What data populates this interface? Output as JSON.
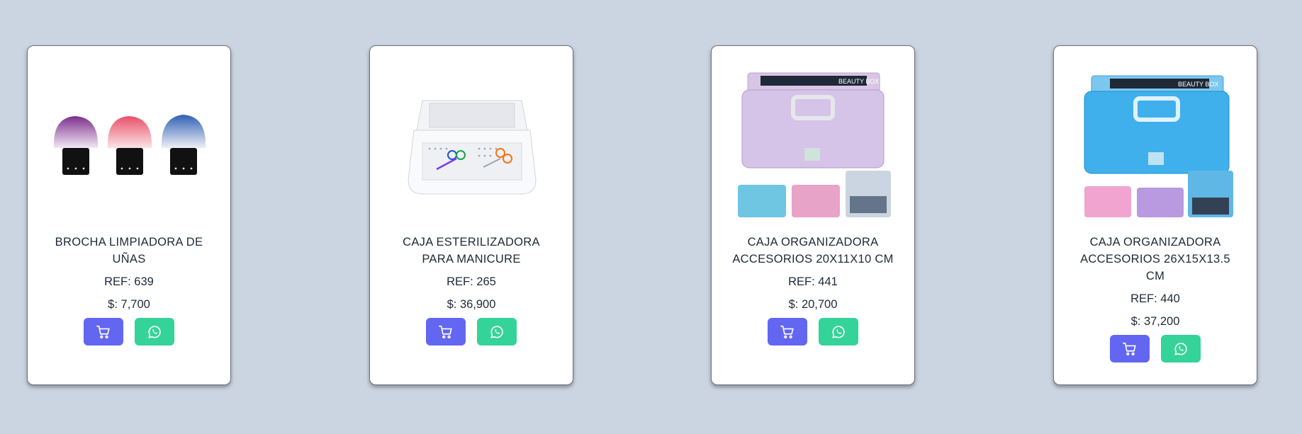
{
  "products": [
    {
      "title": "BROCHA LIMPIADORA DE UÑAS",
      "ref": "REF: 639",
      "price": "$: 7,700",
      "image": "kabuki-brush-set-image",
      "cart_icon": "cart-icon",
      "whatsapp_icon": "whatsapp-icon"
    },
    {
      "title": "CAJA ESTERILIZADORA PARA MANICURE",
      "ref": "REF: 265",
      "price": "$: 36,900",
      "image": "sterilizer-tray-image",
      "cart_icon": "cart-icon",
      "whatsapp_icon": "whatsapp-icon"
    },
    {
      "title": "CAJA ORGANIZADORA ACCESORIOS 20X11X10 CM",
      "ref": "REF: 441",
      "price": "$: 20,700",
      "image": "beauty-box-purple-image",
      "image_label": "BEAUTY BOX",
      "cart_icon": "cart-icon",
      "whatsapp_icon": "whatsapp-icon"
    },
    {
      "title": "CAJA ORGANIZADORA ACCESORIOS 26X15X13.5 CM",
      "ref": "REF: 440",
      "price": "$: 37,200",
      "image": "beauty-box-blue-image",
      "image_label": "BEAUTY BOX",
      "cart_icon": "cart-icon",
      "whatsapp_icon": "whatsapp-icon"
    }
  ],
  "colors": {
    "background": "#cbd5e1",
    "cart_button": "#6366f1",
    "whatsapp_button": "#34d399",
    "card": "#ffffff",
    "text": "#1f2937"
  }
}
